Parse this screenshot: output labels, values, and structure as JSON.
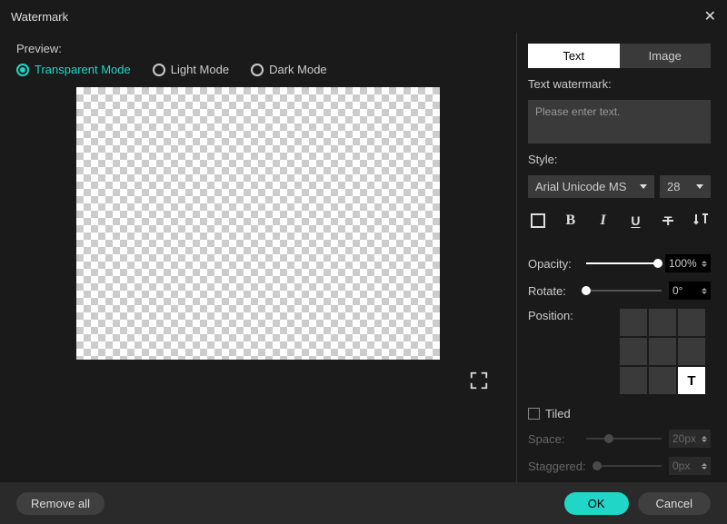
{
  "window": {
    "title": "Watermark"
  },
  "preview": {
    "label": "Preview:",
    "modes": {
      "transparent": "Transparent Mode",
      "light": "Light Mode",
      "dark": "Dark Mode"
    }
  },
  "tabs": {
    "text": "Text",
    "image": "Image"
  },
  "textwm": {
    "label": "Text watermark:",
    "placeholder": "Please enter text."
  },
  "style": {
    "label": "Style:",
    "font": "Arial Unicode MS",
    "size": "28"
  },
  "opacity": {
    "label": "Opacity:",
    "value": "100%"
  },
  "rotate": {
    "label": "Rotate:",
    "value": "0°"
  },
  "position": {
    "label": "Position:",
    "selected_glyph": "T"
  },
  "tiled": {
    "label": "Tiled",
    "space": {
      "label": "Space:",
      "value": "20px"
    },
    "staggered": {
      "label": "Staggered:",
      "value": "0px"
    }
  },
  "footer": {
    "remove": "Remove all",
    "ok": "OK",
    "cancel": "Cancel"
  }
}
